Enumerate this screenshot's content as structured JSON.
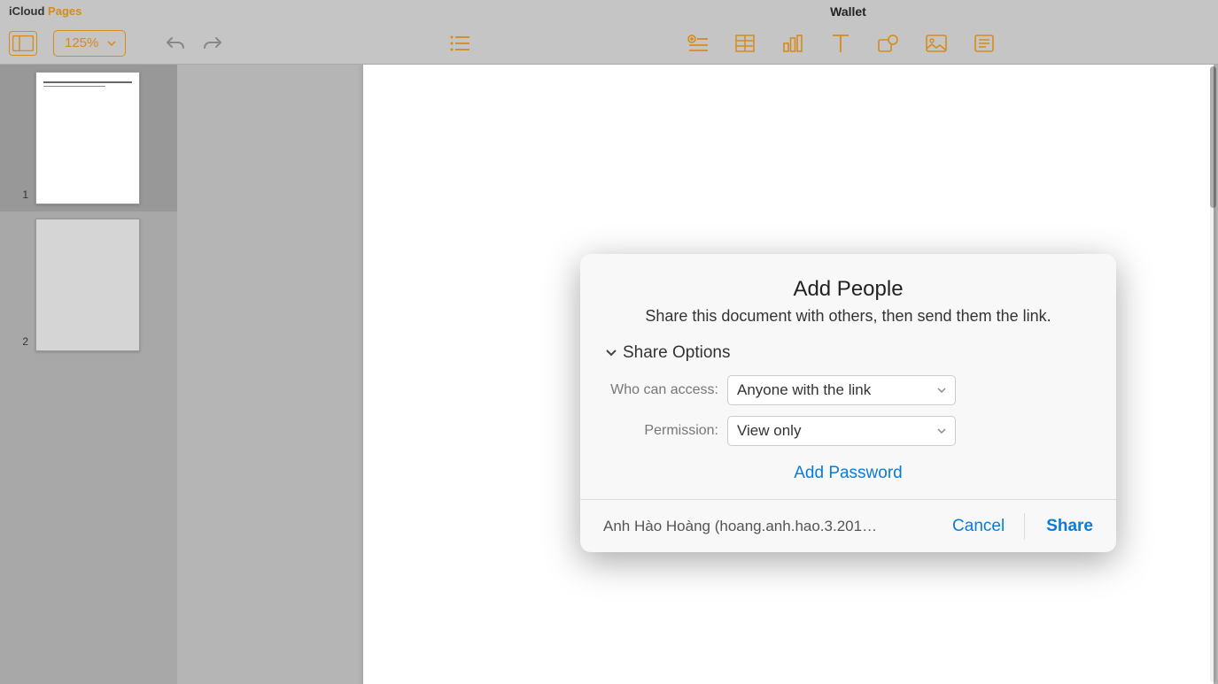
{
  "header": {
    "logo_prefix": "iCloud",
    "logo_suffix": " Pages",
    "doc_title": "Wallet"
  },
  "toolbar": {
    "zoom": "125%"
  },
  "thumbnails": {
    "pages": [
      {
        "num": "1",
        "selected": true,
        "has_content": true
      },
      {
        "num": "2",
        "selected": false,
        "has_content": false
      }
    ]
  },
  "modal": {
    "title": "Add People",
    "subtitle": "Share this document with others, then send them the link.",
    "options_heading": "Share Options",
    "access_label": "Who can access:",
    "access_value": "Anyone with the link",
    "permission_label": "Permission:",
    "permission_value": "View only",
    "add_password": "Add Password",
    "user": "Anh Hào Hoàng (hoang.anh.hao.3.201…",
    "cancel": "Cancel",
    "share": "Share"
  }
}
